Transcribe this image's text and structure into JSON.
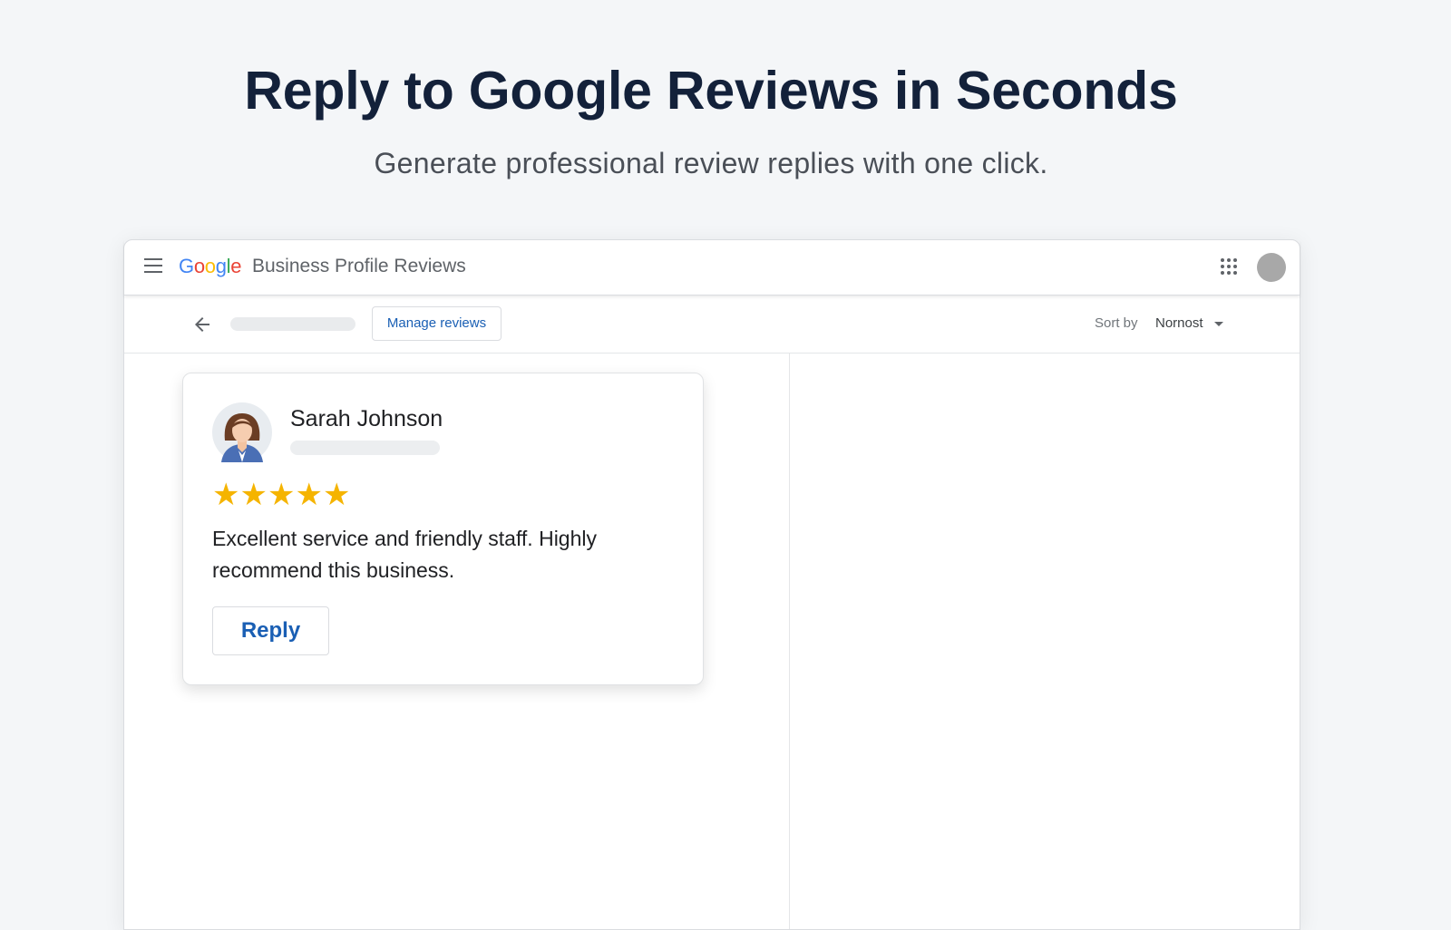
{
  "hero": {
    "title": "Reply to Google Reviews in Seconds",
    "subtitle": "Generate professional review replies with one click."
  },
  "appbar": {
    "logo_letters": [
      {
        "char": "G",
        "color": "#4285F4"
      },
      {
        "char": "o",
        "color": "#EA4335"
      },
      {
        "char": "o",
        "color": "#FBBC05"
      },
      {
        "char": "g",
        "color": "#4285F4"
      },
      {
        "char": "l",
        "color": "#34A853"
      },
      {
        "char": "e",
        "color": "#EA4335"
      }
    ],
    "title": "Business Profile Reviews",
    "menu_icon": "hamburger-menu-icon",
    "apps_icon": "apps-grid-icon",
    "account_icon": "account-avatar"
  },
  "toolbar": {
    "back_icon": "arrow-left-icon",
    "manage_label": "Manage reviews",
    "sort_label": "Sort by",
    "sort_value": "Nornost"
  },
  "review": {
    "name": "Sarah Johnson",
    "rating": 5,
    "stars": [
      "★",
      "★",
      "★",
      "★",
      "★"
    ],
    "text": "Excellent service and friendly staff. Highly recommend this business.",
    "reply_label": "Reply",
    "star_color": "#F5B400"
  },
  "colors": {
    "accent": "#1A5FB4",
    "title": "#13213A",
    "background": "#F4F6F8"
  }
}
